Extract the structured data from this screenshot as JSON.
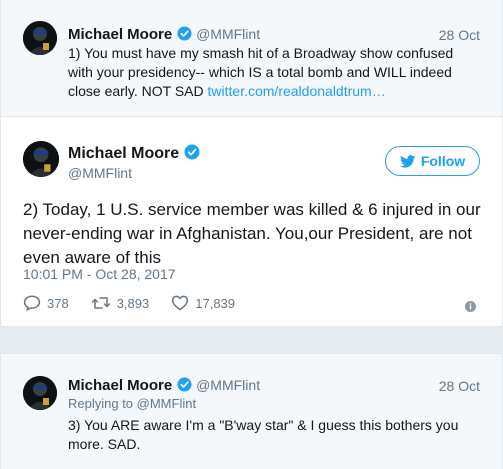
{
  "colors": {
    "page_bg": "#e6ecf0",
    "context_bg": "#f5f8fa",
    "accent": "#1da1f2",
    "verified": "#1da1f2",
    "muted": "#657786"
  },
  "tweet1": {
    "name": "Michael Moore",
    "handle": "@MMFlint",
    "date": "28 Oct",
    "text": "1) You must have my smash hit of a Broadway show confused with your presidency-- which IS a total bomb and WILL indeed close early. NOT SAD ",
    "link": "twitter.com/realdonaldtrum…",
    "icons": [
      "avatar",
      "verified-badge-icon"
    ]
  },
  "tweet2": {
    "name": "Michael Moore",
    "handle": "@MMFlint",
    "follow_label": "Follow",
    "text": "2) Today, 1 U.S. service member was killed & 6 injured in our never-ending war in Afghanistan. You,our President, are not even aware of this",
    "timestamp": "10:01 PM - Oct 28, 2017",
    "replies": "378",
    "retweets": "3,893",
    "likes": "17,839",
    "icons": [
      "twitter-bird-icon",
      "reply-icon",
      "retweet-icon",
      "heart-icon",
      "info-icon"
    ]
  },
  "tweet3": {
    "name": "Michael Moore",
    "handle": "@MMFlint",
    "date": "28 Oct",
    "replying_to": "Replying to @MMFlint",
    "text": "3) You ARE aware I'm a \"B'way star\" & I guess this bothers you more. SAD."
  }
}
